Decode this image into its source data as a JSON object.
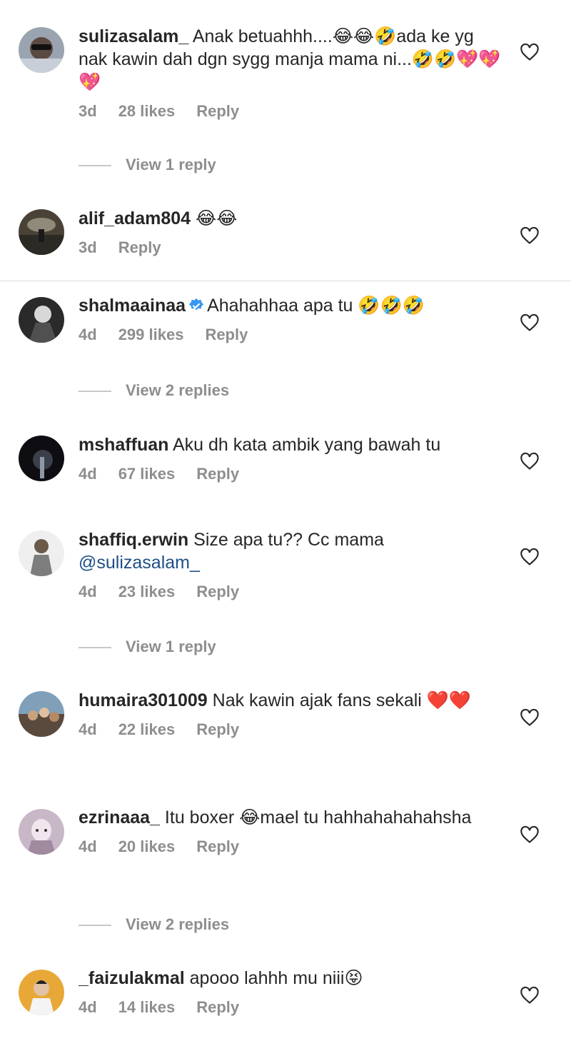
{
  "comments": [
    {
      "username": "sulizasalam_",
      "text": "Anak betuahhh....😂😂🤣ada ke yg nak kawin dah dgn sygg manja mama ni...🤣🤣💖💖💖",
      "time": "3d",
      "likes": "28 likes",
      "reply": "Reply",
      "view_replies": "View 1 reply"
    },
    {
      "username": "alif_adam804",
      "text": "😂😂",
      "time": "3d",
      "likes": "",
      "reply": "Reply"
    },
    {
      "username": "shalmaainaa",
      "verified": true,
      "text": "Ahahahhaa apa tu 🤣🤣🤣",
      "time": "4d",
      "likes": "299 likes",
      "reply": "Reply",
      "view_replies": "View 2 replies"
    },
    {
      "username": "mshaffuan",
      "text": "Aku dh kata ambik yang bawah tu",
      "time": "4d",
      "likes": "67 likes",
      "reply": "Reply"
    },
    {
      "username": "shaffiq.erwin",
      "text": "Size apa tu?? Cc mama",
      "mention": "@sulizasalam_",
      "time": "4d",
      "likes": "23 likes",
      "reply": "Reply",
      "view_replies": "View 1 reply"
    },
    {
      "username": "humaira301009",
      "text": "Nak kawin ajak fans sekali ❤️❤️",
      "time": "4d",
      "likes": "22 likes",
      "reply": "Reply"
    },
    {
      "username": "ezrinaaa_",
      "text": "Itu boxer 😂mael tu hahhahahahahsha",
      "time": "4d",
      "likes": "20 likes",
      "reply": "Reply",
      "view_replies": "View 2 replies"
    },
    {
      "username": "_faizulakmal",
      "text": "apooo lahhh mu niii😝",
      "time": "4d",
      "likes": "14 likes",
      "reply": "Reply"
    }
  ],
  "colors": {
    "text": "#262626",
    "secondary": "#8e8e8e",
    "mention": "#1d4f86",
    "verified": "#3897f0"
  }
}
